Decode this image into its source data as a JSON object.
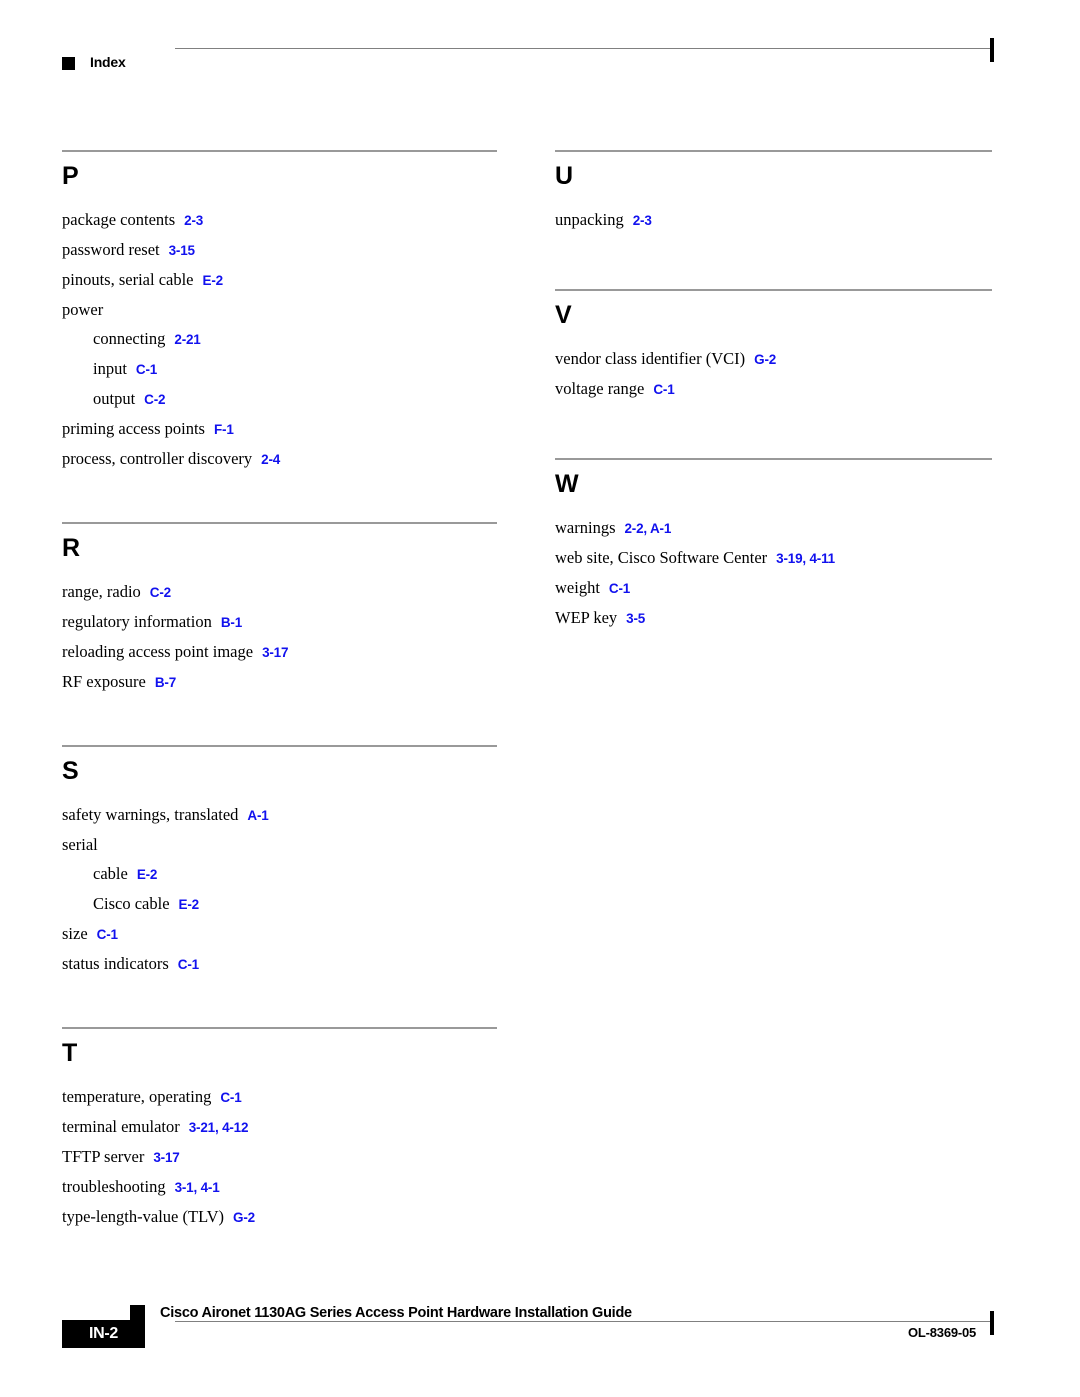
{
  "header": {
    "marker_icon": "black-square-icon",
    "title": "Index"
  },
  "columns": {
    "left": [
      {
        "letter": "P",
        "entries": [
          {
            "term": "package contents",
            "pages": "2-3",
            "level": 0
          },
          {
            "term": "password reset",
            "pages": "3-15",
            "level": 0
          },
          {
            "term": "pinouts, serial cable",
            "pages": "E-2",
            "level": 0
          },
          {
            "term": "power",
            "pages": "",
            "level": 0
          },
          {
            "term": "connecting",
            "pages": "2-21",
            "level": 1
          },
          {
            "term": "input",
            "pages": "C-1",
            "level": 1
          },
          {
            "term": "output",
            "pages": "C-2",
            "level": 1
          },
          {
            "term": "priming access points",
            "pages": "F-1",
            "level": 0
          },
          {
            "term": "process, controller discovery",
            "pages": "2-4",
            "level": 0
          }
        ]
      },
      {
        "letter": "R",
        "entries": [
          {
            "term": "range, radio",
            "pages": "C-2",
            "level": 0
          },
          {
            "term": "regulatory information",
            "pages": "B-1",
            "level": 0
          },
          {
            "term": "reloading access point image",
            "pages": "3-17",
            "level": 0
          },
          {
            "term": "RF exposure",
            "pages": "B-7",
            "level": 0
          }
        ]
      },
      {
        "letter": "S",
        "entries": [
          {
            "term": "safety warnings, translated",
            "pages": "A-1",
            "level": 0
          },
          {
            "term": "serial",
            "pages": "",
            "level": 0
          },
          {
            "term": "cable",
            "pages": "E-2",
            "level": 1
          },
          {
            "term": "Cisco cable",
            "pages": "E-2",
            "level": 1
          },
          {
            "term": "size",
            "pages": "C-1",
            "level": 0
          },
          {
            "term": "status indicators",
            "pages": "C-1",
            "level": 0
          }
        ]
      },
      {
        "letter": "T",
        "entries": [
          {
            "term": "temperature, operating",
            "pages": "C-1",
            "level": 0
          },
          {
            "term": "terminal emulator",
            "pages": "3-21, 4-12",
            "level": 0
          },
          {
            "term": "TFTP server",
            "pages": "3-17",
            "level": 0
          },
          {
            "term": "troubleshooting",
            "pages": "3-1, 4-1",
            "level": 0
          },
          {
            "term": "type-length-value (TLV)",
            "pages": "G-2",
            "level": 0
          }
        ]
      }
    ],
    "right": [
      {
        "letter": "U",
        "entries": [
          {
            "term": "unpacking",
            "pages": "2-3",
            "level": 0
          }
        ]
      },
      {
        "letter": "V",
        "entries": [
          {
            "term": "vendor class identifier (VCI)",
            "pages": "G-2",
            "level": 0
          },
          {
            "term": "voltage range",
            "pages": "C-1",
            "level": 0
          }
        ]
      },
      {
        "letter": "W",
        "entries": [
          {
            "term": "warnings",
            "pages": "2-2, A-1",
            "level": 0
          },
          {
            "term": "web site, Cisco Software Center",
            "pages": "3-19, 4-11",
            "level": 0
          },
          {
            "term": "weight",
            "pages": "C-1",
            "level": 0
          },
          {
            "term": "WEP key",
            "pages": "3-5",
            "level": 0
          }
        ]
      }
    ]
  },
  "footer": {
    "page_number": "IN-2",
    "marker_icon": "black-square-icon",
    "title": "Cisco Aironet 1130AG Series Access Point Hardware Installation Guide",
    "doc_number": "OL-8369-05"
  },
  "colors": {
    "page_reference": "#1111ee",
    "rule": "#999999",
    "text": "#000000"
  }
}
